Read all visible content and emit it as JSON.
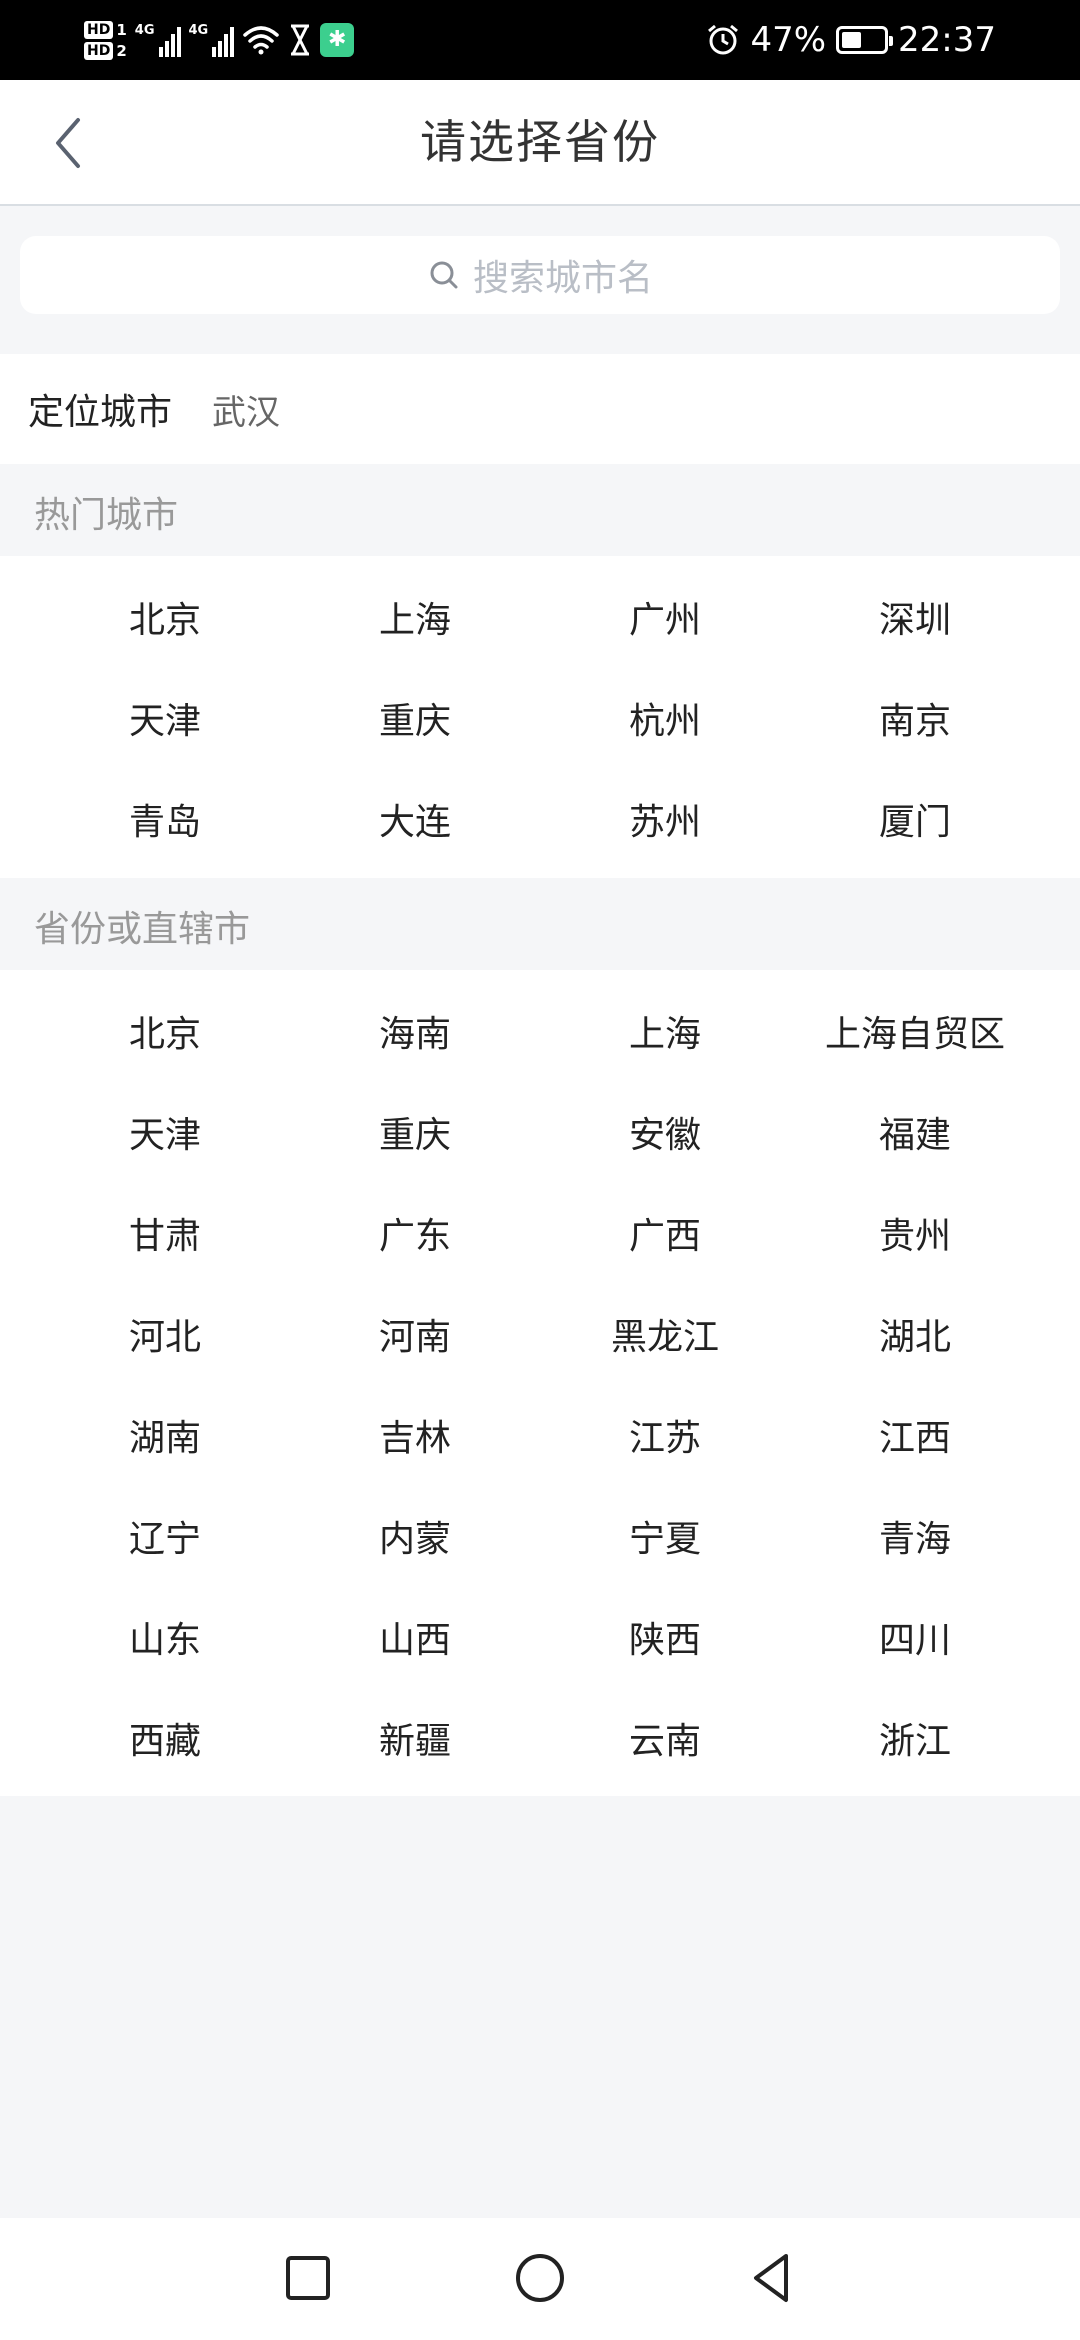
{
  "status_bar": {
    "sim1": "HD",
    "sim1_num": "1",
    "sim2": "HD",
    "sim2_num": "2",
    "network1": "4G",
    "network2": "4G",
    "battery_percent": "47%",
    "battery_level": 0.47,
    "time": "22:37",
    "icons": [
      "signal-icon",
      "wifi-icon",
      "hourglass-icon",
      "app-notification-icon",
      "alarm-icon",
      "battery-icon"
    ]
  },
  "header": {
    "title": "请选择省份",
    "back_icon": "chevron-left-icon"
  },
  "search": {
    "icon": "search-icon",
    "placeholder": "搜索城市名"
  },
  "location": {
    "label": "定位城市",
    "city": "武汉"
  },
  "hot_cities": {
    "title": "热门城市",
    "rows": [
      [
        "北京",
        "上海",
        "广州",
        "深圳"
      ],
      [
        "天津",
        "重庆",
        "杭州",
        "南京"
      ],
      [
        "青岛",
        "大连",
        "苏州",
        "厦门"
      ]
    ]
  },
  "provinces": {
    "title": "省份或直辖市",
    "rows": [
      [
        "北京",
        "海南",
        "上海",
        "上海自贸区"
      ],
      [
        "天津",
        "重庆",
        "安徽",
        "福建"
      ],
      [
        "甘肃",
        "广东",
        "广西",
        "贵州"
      ],
      [
        "河北",
        "河南",
        "黑龙江",
        "湖北"
      ],
      [
        "湖南",
        "吉林",
        "江苏",
        "江西"
      ],
      [
        "辽宁",
        "内蒙",
        "宁夏",
        "青海"
      ],
      [
        "山东",
        "山西",
        "陕西",
        "四川"
      ],
      [
        "西藏",
        "新疆",
        "云南",
        "浙江"
      ]
    ]
  },
  "nav_bar": {
    "icons": [
      "recents-square-icon",
      "home-circle-icon",
      "back-triangle-icon"
    ]
  }
}
